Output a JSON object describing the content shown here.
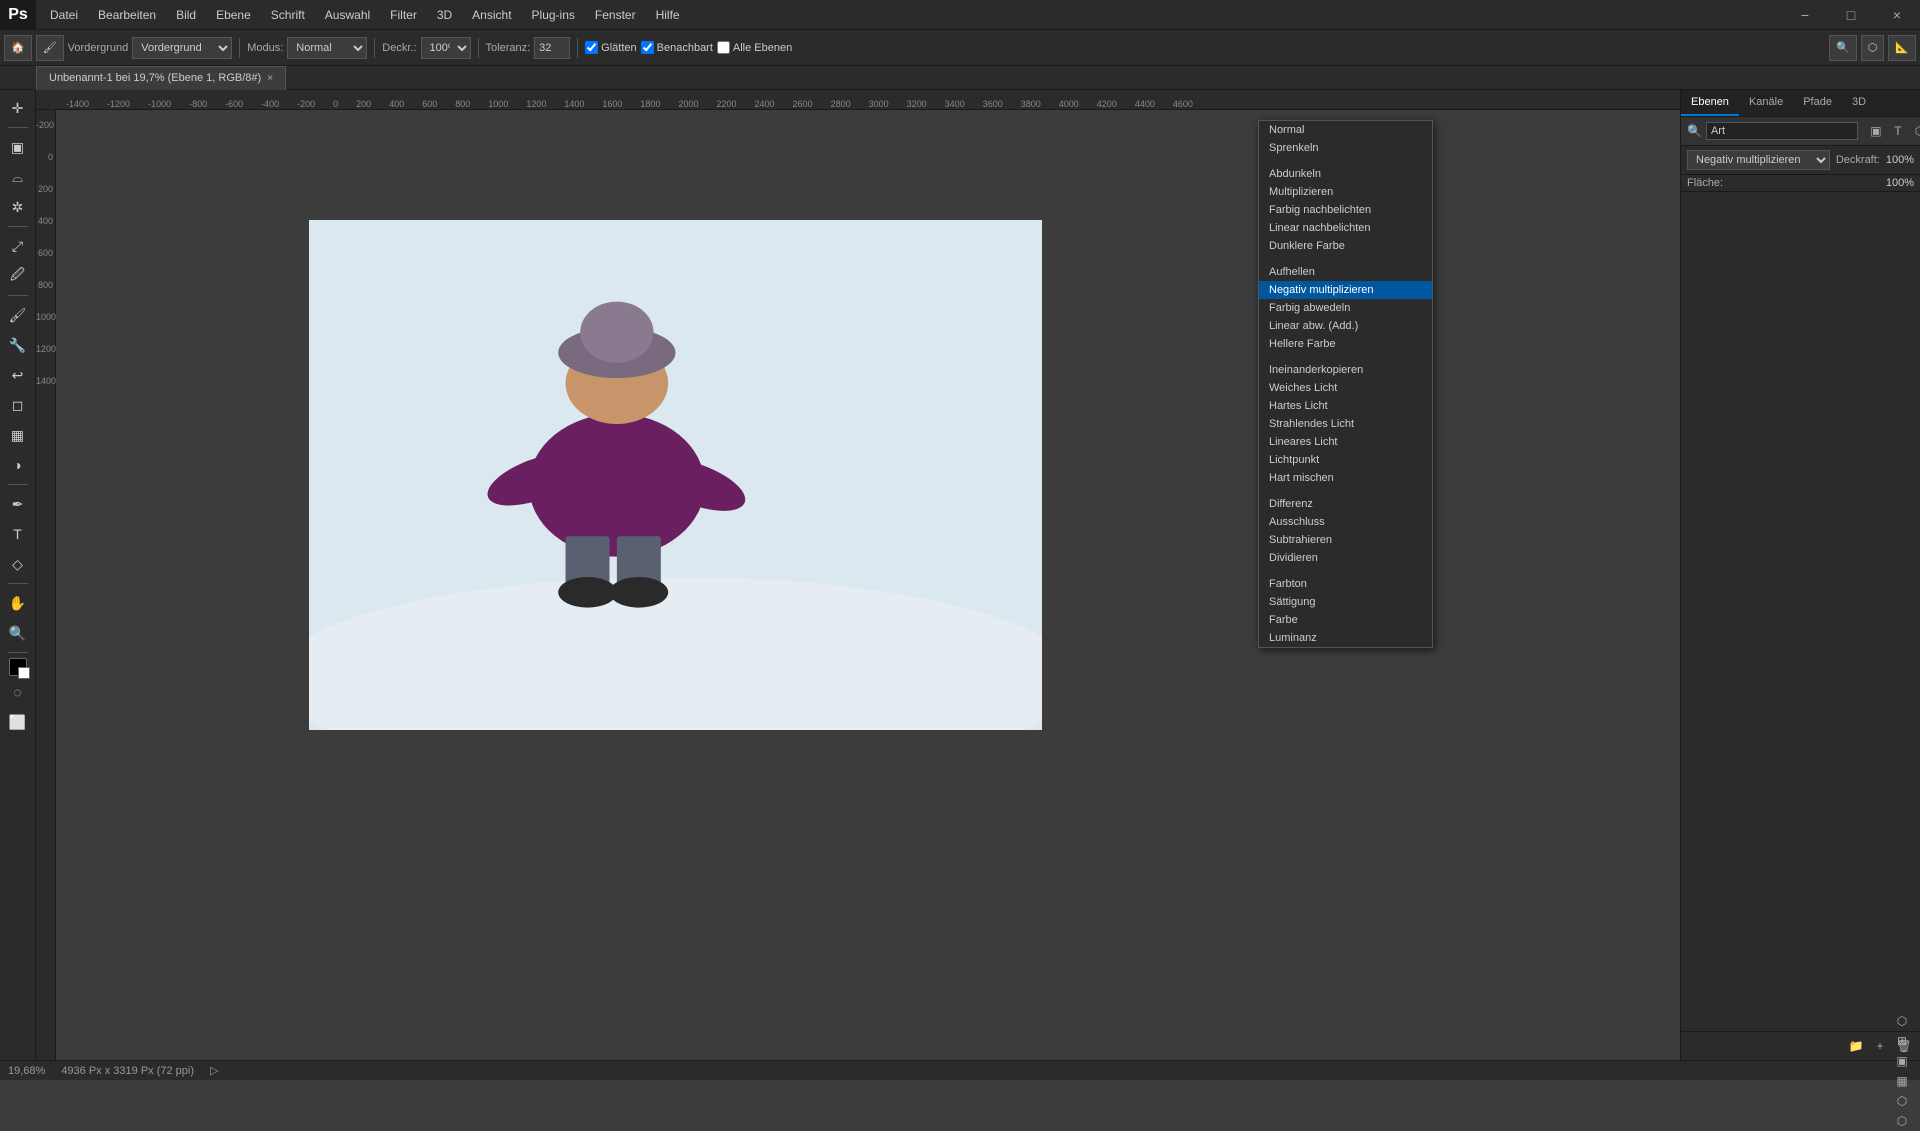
{
  "app": {
    "name": "Photoshop",
    "logo": "Ps"
  },
  "menubar": {
    "items": [
      "Datei",
      "Bearbeiten",
      "Bild",
      "Ebene",
      "Schrift",
      "Auswahl",
      "Filter",
      "3D",
      "Ansicht",
      "Plug-ins",
      "Fenster",
      "Hilfe"
    ]
  },
  "toolbar": {
    "vordergrund_label": "Vordergrund",
    "modus_label": "Modus:",
    "modus_value": "Normal",
    "deckraft_label": "Deckr.:",
    "deckraft_value": "100%",
    "toleranz_label": "Toleranz:",
    "toleranz_value": "32",
    "glatten_label": "Glätten",
    "benachbart_label": "Benachbart",
    "alle_ebenen_label": "Alle Ebenen"
  },
  "tab": {
    "title": "Unbenannt-1 bei 19,7% (Ebene 1, RGB/8#)",
    "close": "×"
  },
  "panel_tabs": [
    "Ebenen",
    "Kanäle",
    "Pfade",
    "3D"
  ],
  "panel_search_placeholder": "Art",
  "layer_controls": {
    "blend_mode_label": "Negativ multiplizieren",
    "deckraft_label": "Deckraft:",
    "deckraft_value": "100%",
    "flache_label": "Fläche:",
    "flache_value": "100%"
  },
  "blend_modes": {
    "groups": [
      {
        "items": [
          "Normal",
          "Sprenkeln"
        ]
      },
      {
        "items": [
          "Abdunkeln",
          "Multiplizieren",
          "Farbig nachbelichten",
          "Linear nachbelichten",
          "Dunklere Farbe"
        ]
      },
      {
        "items": [
          "Aufhellen",
          "Negativ multiplizieren",
          "Farbig abwedeln",
          "Linear abw. (Add.)",
          "Hellere Farbe"
        ]
      },
      {
        "items": [
          "Ineinanderkopieren",
          "Weiches Licht",
          "Hartes Licht",
          "Strahlendes Licht",
          "Lineares Licht",
          "Lichtpunkt",
          "Hart mischen"
        ]
      },
      {
        "items": [
          "Differenz",
          "Ausschluss",
          "Subtrahieren",
          "Dividieren"
        ]
      },
      {
        "items": [
          "Farbton",
          "Sättigung",
          "Farbe",
          "Luminanz"
        ]
      }
    ],
    "selected": "Negativ multiplizieren"
  },
  "status_bar": {
    "zoom": "19,68%",
    "dimensions": "4936 Px x 3319 Px (72 ppi)",
    "progress": ""
  },
  "ruler": {
    "h_ticks": [
      "-1400",
      "-1200",
      "-1000",
      "-800",
      "-600",
      "-400",
      "-200",
      "0",
      "200",
      "400",
      "600",
      "800",
      "1000",
      "1200",
      "1400",
      "1600",
      "1800",
      "2000",
      "2200",
      "2400",
      "2600",
      "2800",
      "3000",
      "3200",
      "3400",
      "3600",
      "3800",
      "4000",
      "4200",
      "4400",
      "4600"
    ],
    "v_ticks": [
      "-200",
      "0",
      "200",
      "400",
      "600",
      "800",
      "1000",
      "1200",
      "1400"
    ]
  },
  "window_controls": {
    "minimize": "−",
    "maximize": "□",
    "close": "×"
  },
  "left_tools": [
    "⬡",
    "🔄",
    "○",
    "⬡",
    "✏",
    "⬡",
    "⬡",
    "⬡",
    "🔲",
    "T",
    "⬡",
    "⬡",
    "🖐",
    "⬡",
    "⬡",
    "⬡",
    "⬡",
    "⬡",
    "⬡",
    "⬡",
    "🎨"
  ]
}
